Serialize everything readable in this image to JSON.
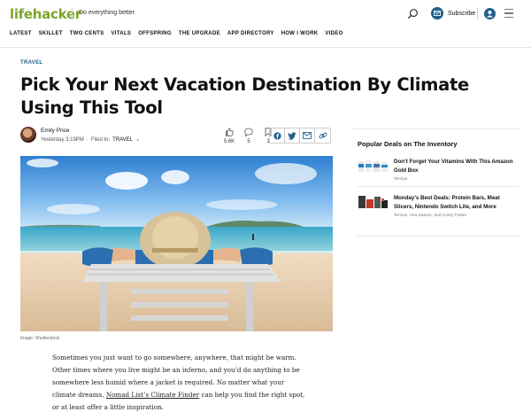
{
  "header": {
    "logo_part1": "life",
    "logo_part2": "hacker",
    "tagline": "Do everything better",
    "subscribe_label": "Subscribe"
  },
  "nav": {
    "items": [
      "LATEST",
      "SKILLET",
      "TWO CENTS",
      "VITALS",
      "OFFSPRING",
      "THE UPGRADE",
      "APP DIRECTORY",
      "HOW I WORK",
      "VIDEO"
    ]
  },
  "article": {
    "category": "TRAVEL",
    "title": "Pick Your Next Vacation Destination By Climate Using This Tool",
    "author": "Emily Price",
    "time": "Yesterday 3:19PM",
    "filed_to_label": "Filed to:",
    "filed_to": "TRAVEL",
    "stats": {
      "likes": "5.6K",
      "comments": "5",
      "bookmarks": "1"
    },
    "image_caption": "Image: Shutterstock",
    "body_before_link": "Sometimes you just want to go somewhere, anywhere, that might be warm. Other times where you live might be an inferno, and you’d do anything to be somewhere less humid where a jacket is required. No matter what your climate dreams, ",
    "body_link": "Nomad List’s Climate Finder",
    "body_after_link": " can help you find the right spot, or at least offer a little inspiration."
  },
  "sidebar": {
    "heading": "Popular Deals on The Inventory",
    "deals": [
      {
        "title": "Don’t Forget Your Vitamins With This Amazon Gold Box",
        "author": "Tercius"
      },
      {
        "title": "Monday’s Best Deals: Protein Bars, Meat Slicers, Nintendo Switch Lite, and More",
        "author": "Tercius, Ana Suarez, and Corey Foster"
      }
    ]
  },
  "colors": {
    "brand_green": "#7fa52a",
    "accent_blue": "#1f5f8b"
  }
}
